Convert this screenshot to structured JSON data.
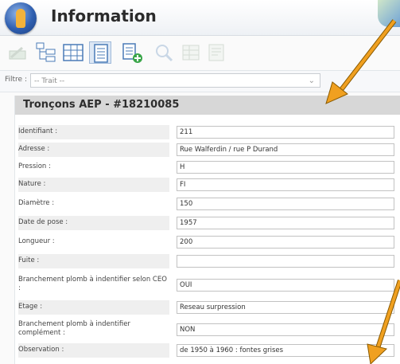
{
  "header": {
    "title": "Information"
  },
  "toolbar": {
    "buttons": [
      {
        "icon": "clear-selection-icon",
        "enabled": false
      },
      {
        "icon": "tree-view-icon",
        "enabled": true
      },
      {
        "icon": "grid-view-icon",
        "enabled": true
      },
      {
        "icon": "form-view-icon",
        "enabled": true,
        "active": true
      },
      {
        "icon": "export-icon",
        "enabled": true
      },
      {
        "icon": "zoom-icon",
        "enabled": false
      },
      {
        "icon": "table-icon",
        "enabled": false
      },
      {
        "icon": "report-icon",
        "enabled": false
      }
    ]
  },
  "filter": {
    "label": "Filtre :",
    "value": "-- Trait --"
  },
  "panel": {
    "title": "Tronçons AEP - #18210085",
    "fields": [
      {
        "label": "Identifiant :",
        "value": "211"
      },
      {
        "label": "Adresse :",
        "value": "Rue Walferdin / rue P Durand"
      },
      {
        "label": "Pression :",
        "value": "H"
      },
      {
        "label": "Nature :",
        "value": "FI"
      },
      {
        "label": "Diamètre :",
        "value": "150"
      },
      {
        "label": "Date de pose :",
        "value": "1957"
      },
      {
        "label": "Longueur :",
        "value": "200"
      },
      {
        "label": "Fuite :",
        "value": ""
      },
      {
        "label": "Branchement plomb à indentifier selon CEO :",
        "value": "OUI"
      },
      {
        "label": "Etage :",
        "value": "Reseau surpression"
      },
      {
        "label": "Branchement plomb à indentifier complément :",
        "value": "NON"
      },
      {
        "label": "Observation :",
        "value": "de 1950 à 1960 : fontes grises"
      }
    ]
  },
  "colors": {
    "annotation_arrow": "#f0a020",
    "header_band": "#d7d7d7"
  }
}
